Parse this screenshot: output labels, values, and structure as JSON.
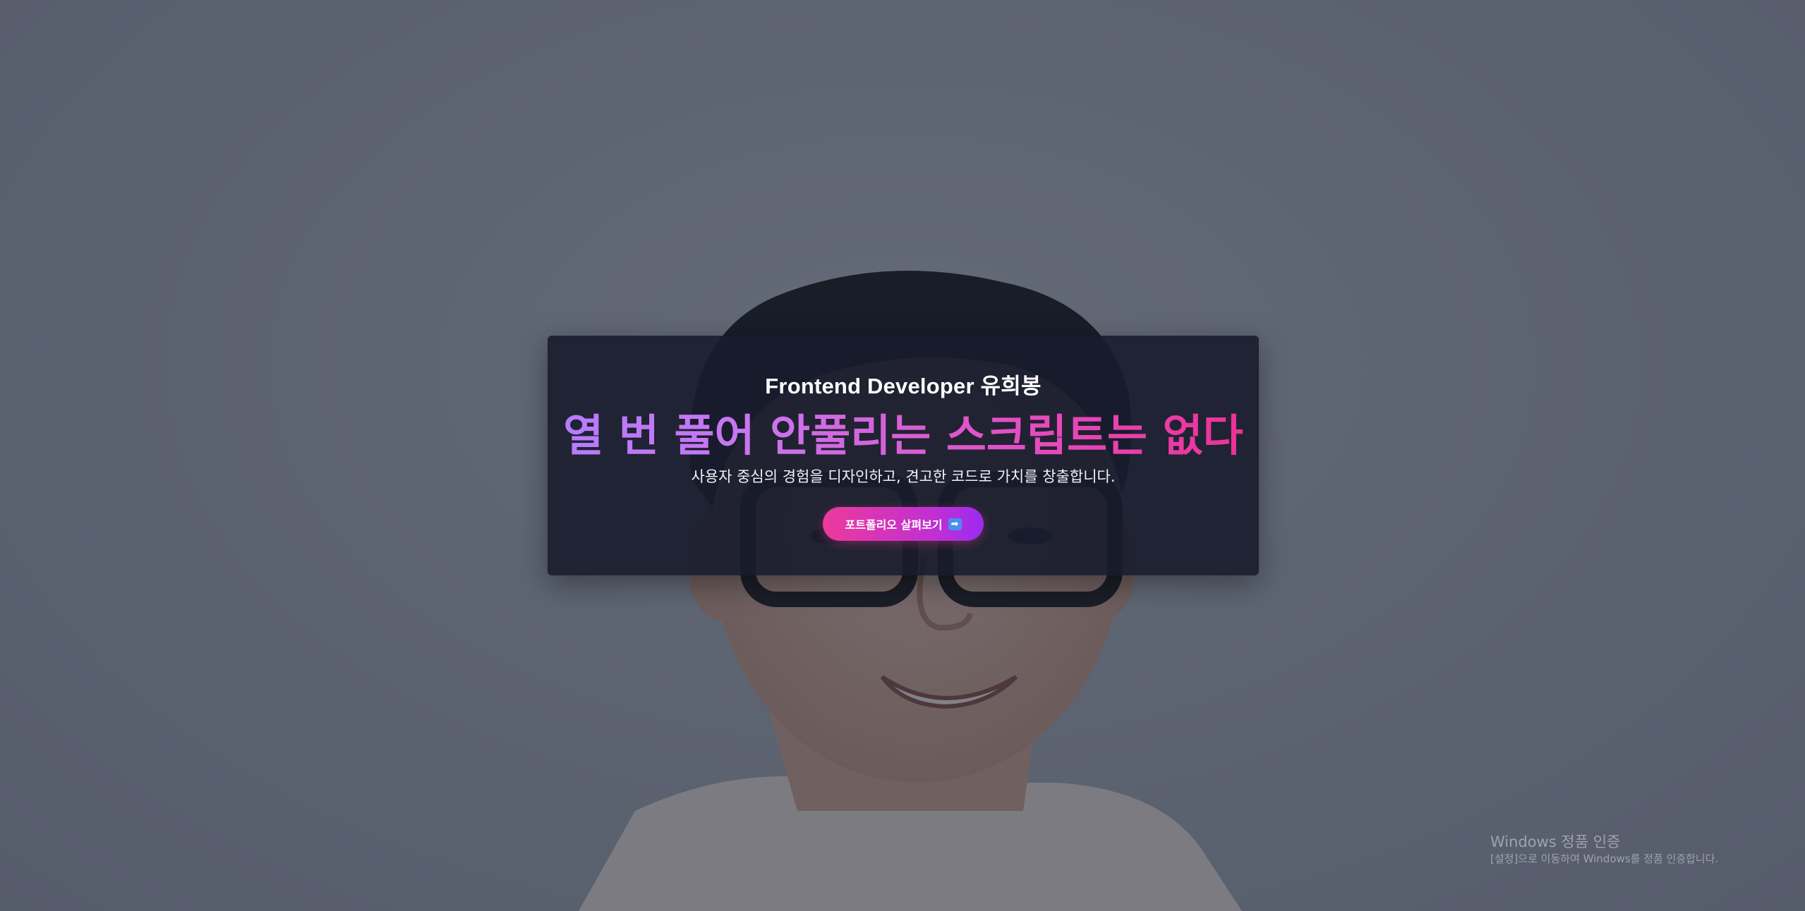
{
  "hero": {
    "subtitle": "Frontend Developer 유희봉",
    "headline": "열 번 풀어 안풀리는 스크립트는 없다",
    "tagline": "사용자 중심의 경험을 디자인하고, 견고한 코드로 가치를 창출합니다.",
    "cta_label": "포트폴리오 살펴보기",
    "cta_icon": "➡",
    "colors": {
      "headline_gradient_start": "#b57cff",
      "headline_gradient_end": "#ef2f93",
      "button_gradient_start": "#ec3a9c",
      "button_gradient_end": "#9b2cf0",
      "card_background": "#181c2c"
    }
  },
  "background": {
    "image": "portrait-photo"
  },
  "os_watermark": {
    "title": "Windows 정품 인증",
    "subtitle": "[설정]으로 이동하여 Windows를 정품 인증합니다."
  }
}
